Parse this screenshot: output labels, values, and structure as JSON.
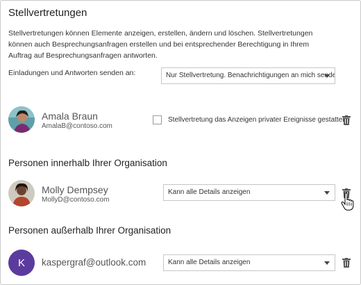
{
  "heading": "Stellvertretungen",
  "description": "Stellvertretungen können Elemente anzeigen, erstellen, ändern und löschen. Stellvertretungen können auch Besprechungsanfragen erstellen und bei entsprechender Berechtigung in Ihrem Auftrag auf Besprechungsanfragen antworten.",
  "send_to": {
    "label": "Einladungen und Antworten senden an:",
    "selected": "Nur Stellvertretung. Benachrichtigungen an mich senden."
  },
  "delegate": {
    "name": "Amala Braun",
    "email": "AmalaB@contoso.com",
    "private_events_label": "Stellvertretung das Anzeigen privater Ereignisse gestatten",
    "private_events_checked": false
  },
  "internal": {
    "heading": "Personen innerhalb Ihrer Organisation",
    "person": {
      "name": "Molly Dempsey",
      "email": "MollyD@contoso.com",
      "permission": "Kann alle Details anzeigen"
    }
  },
  "external": {
    "heading": "Personen außerhalb Ihrer Organisation",
    "person": {
      "initial": "K",
      "email": "kaspergraf@outlook.com",
      "permission": "Kann alle Details anzeigen",
      "avatar_color": "#5c3b9e"
    }
  },
  "icons": {
    "delete": "trash-icon",
    "cursor": "hand-pointer-icon"
  }
}
